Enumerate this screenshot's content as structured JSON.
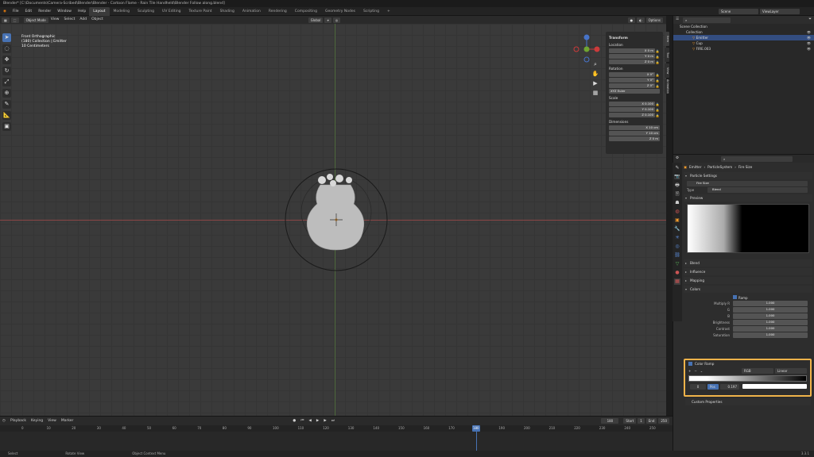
{
  "window": {
    "title": "Blender* [C:\\Documents\\Camera-Scribed\\Blender\\Blender - Cartoon Flame - Rain Tile Handheld\\Blender Follow along.blend]"
  },
  "menu": [
    "File",
    "Edit",
    "Render",
    "Window",
    "Help"
  ],
  "workspaces": [
    "Layout",
    "Modeling",
    "Sculpting",
    "UV Editing",
    "Texture Paint",
    "Shading",
    "Animation",
    "Rendering",
    "Compositing",
    "Geometry Nodes",
    "Scripting"
  ],
  "active_workspace": "Layout",
  "topbar_right": {
    "scene": "Scene",
    "view_layer": "ViewLayer"
  },
  "viewport_header": {
    "mode": "Object Mode",
    "view": "View",
    "select": "Select",
    "add": "Add",
    "object": "Object",
    "orientation": "Global",
    "options": "Options"
  },
  "viewport_info": {
    "line1": "Front Orthographic",
    "line2": "(180) Collection | Emitter",
    "line3": "10 Centimeters"
  },
  "npanel": {
    "title": "Transform",
    "location_label": "Location",
    "location": [
      "X 0 m",
      "Y 0 m",
      "Z 0 m"
    ],
    "rotation_label": "Rotation",
    "rotation": [
      "X 0°",
      "Y 0°",
      "Z 0°"
    ],
    "rotation_mode": "XYZ Euler",
    "scale_label": "Scale",
    "scale": [
      "X 0.100",
      "Y 0.100",
      "Z 0.100"
    ],
    "dimensions_label": "Dimensions",
    "dimensions": [
      "X 10 cm",
      "Y 10 cm",
      "Z 0 m"
    ],
    "tabs": [
      "Item",
      "Tool",
      "View",
      "Animation"
    ]
  },
  "outliner": {
    "header": "Scene Collection",
    "rows": [
      "Scene Collection",
      "Collection",
      "Emitter",
      "Cup",
      "FIRE.003"
    ]
  },
  "properties": {
    "breadcrumb": [
      "Emitter",
      "ParticleSystem",
      "Fire Size"
    ],
    "texture_section": "Particle Settings",
    "texture_name": "Fire Size",
    "type_label": "Type",
    "type_value": "Blend",
    "sections": [
      "Preview",
      "Blend",
      "Influence",
      "Mapping",
      "Colors"
    ],
    "ramp_checkbox": "Ramp",
    "color_rows": [
      {
        "label": "Multiply R",
        "value": "1.000"
      },
      {
        "label": "G",
        "value": "1.000"
      },
      {
        "label": "B",
        "value": "1.000"
      },
      {
        "label": "Brightness",
        "value": "1.000"
      },
      {
        "label": "Contrast",
        "value": "1.000"
      },
      {
        "label": "Saturation",
        "value": "1.000"
      }
    ],
    "color_ramp_label": "Color Ramp",
    "ramp_interp": "RGB",
    "ramp_mode": "Linear",
    "ramp_stop_index": "0",
    "ramp_stop_pos_label": "Pos",
    "ramp_stop_pos": "0.197",
    "custom_props": "Custom Properties"
  },
  "timeline": {
    "menus": [
      "Playback",
      "Keying",
      "View",
      "Marker"
    ],
    "current_frame": "180",
    "start_label": "Start",
    "start": "1",
    "end_label": "End",
    "end": "250",
    "ticks": [
      "0",
      "10",
      "20",
      "30",
      "40",
      "50",
      "60",
      "70",
      "80",
      "90",
      "100",
      "110",
      "120",
      "130",
      "140",
      "150",
      "160",
      "170",
      "180",
      "190",
      "200",
      "210",
      "220",
      "230",
      "240",
      "250"
    ]
  },
  "statusbar": [
    "Select",
    "Rotate View",
    "Object Context Menu"
  ],
  "version": "3.3.1"
}
